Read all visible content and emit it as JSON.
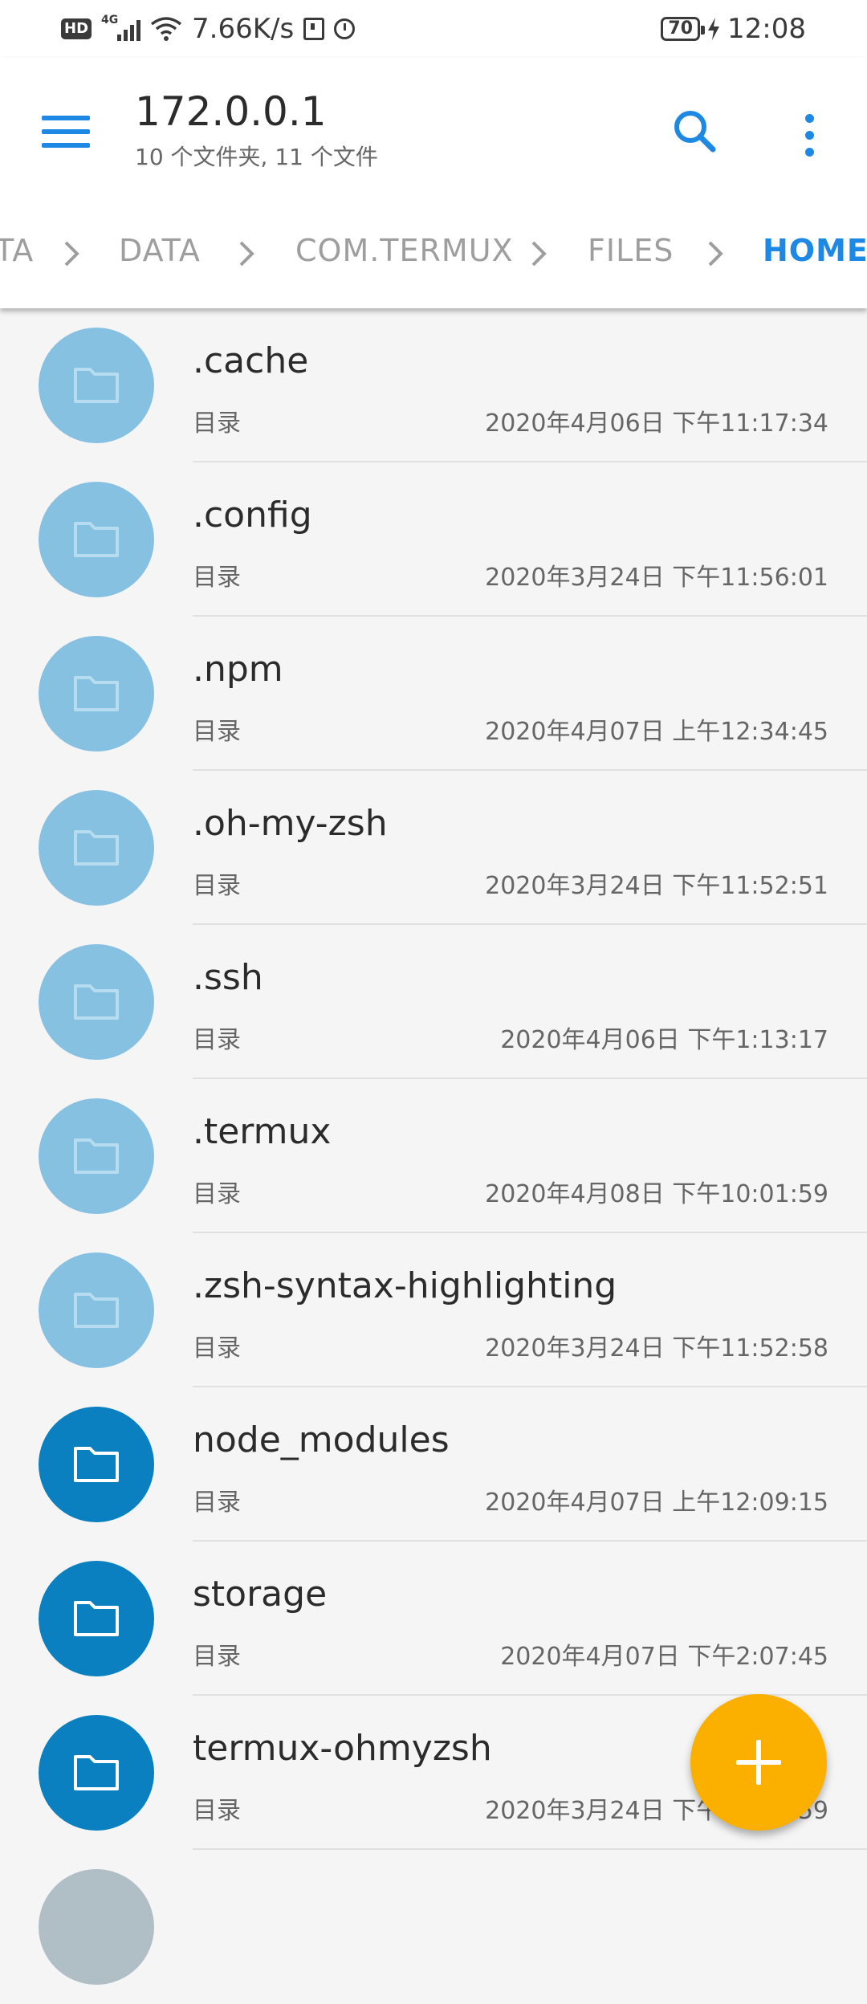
{
  "status_bar": {
    "net_badge": "HD",
    "signal_type": "4G",
    "speed": "7.66K/s",
    "battery": "70",
    "time": "12:08"
  },
  "app_bar": {
    "title": "172.0.0.1",
    "subtitle": "10 个文件夹, 11 个文件",
    "accent_color": "#1e88e5"
  },
  "breadcrumbs": [
    "TA",
    "DATA",
    "COM.TERMUX",
    "FILES",
    "HOME"
  ],
  "files": [
    {
      "name": ".cache",
      "type": "目录",
      "date": "2020年4月06日 下午11:17:34",
      "hidden": true
    },
    {
      "name": ".config",
      "type": "目录",
      "date": "2020年3月24日 下午11:56:01",
      "hidden": true
    },
    {
      "name": ".npm",
      "type": "目录",
      "date": "2020年4月07日 上午12:34:45",
      "hidden": true
    },
    {
      "name": ".oh-my-zsh",
      "type": "目录",
      "date": "2020年3月24日 下午11:52:51",
      "hidden": true
    },
    {
      "name": ".ssh",
      "type": "目录",
      "date": "2020年4月06日 下午1:13:17",
      "hidden": true
    },
    {
      "name": ".termux",
      "type": "目录",
      "date": "2020年4月08日 下午10:01:59",
      "hidden": true
    },
    {
      "name": ".zsh-syntax-highlighting",
      "type": "目录",
      "date": "2020年3月24日 下午11:52:58",
      "hidden": true
    },
    {
      "name": "node_modules",
      "type": "目录",
      "date": "2020年4月07日 上午12:09:15",
      "hidden": false
    },
    {
      "name": "storage",
      "type": "目录",
      "date": "2020年4月07日 下午2:07:45",
      "hidden": false
    },
    {
      "name": "termux-ohmyzsh",
      "type": "目录",
      "date": "2020年3月24日 下午11:52:59",
      "hidden": false
    }
  ],
  "fab": {
    "icon": "plus-icon",
    "color": "#fbb000"
  }
}
